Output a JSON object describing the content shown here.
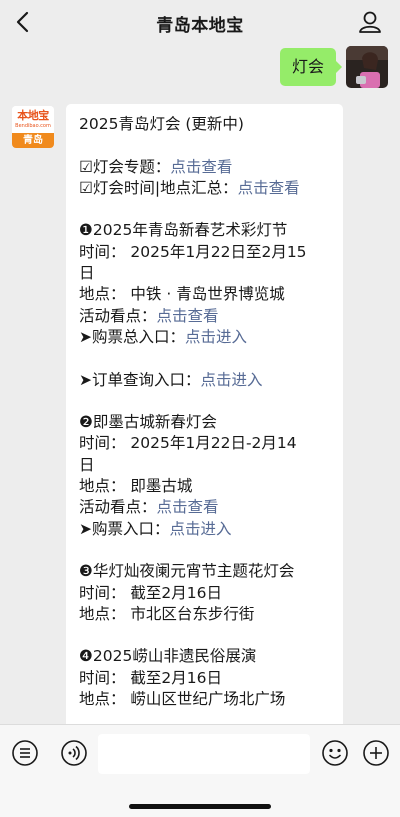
{
  "nav": {
    "title": "青岛本地宝",
    "back_icon": "chevron-left-icon",
    "profile_icon": "person-icon"
  },
  "outgoing": {
    "text": "灯会"
  },
  "incoming": {
    "avatar": {
      "logo_cn": "本地宝",
      "logo_en": "Bendibao.com",
      "city": "青岛"
    },
    "lines": [
      {
        "text": "2025青岛灯会 (更新中)",
        "link": ""
      },
      {
        "text": "",
        "link": ""
      },
      {
        "text": "☑灯会专题：",
        "link": "点击查看"
      },
      {
        "text": "☑灯会时间|地点汇总：",
        "link": "点击查看"
      },
      {
        "text": "",
        "link": ""
      },
      {
        "text": "❶2025年青岛新春艺术彩灯节",
        "link": ""
      },
      {
        "text": "时间： 2025年1月22日至2月15",
        "link": ""
      },
      {
        "text": "日",
        "link": ""
      },
      {
        "text": "地点： 中铁 · 青岛世界博览城",
        "link": ""
      },
      {
        "text": "活动看点：",
        "link": "点击查看"
      },
      {
        "text": "➤购票总入口：",
        "link": "点击进入"
      },
      {
        "text": "",
        "link": ""
      },
      {
        "text": "➤订单查询入口：",
        "link": "点击进入"
      },
      {
        "text": "",
        "link": ""
      },
      {
        "text": "❷即墨古城新春灯会",
        "link": ""
      },
      {
        "text": "时间： 2025年1月22日-2月14",
        "link": ""
      },
      {
        "text": "日",
        "link": ""
      },
      {
        "text": "地点： 即墨古城",
        "link": ""
      },
      {
        "text": "活动看点：",
        "link": "点击查看"
      },
      {
        "text": "➤购票入口：",
        "link": "点击进入"
      },
      {
        "text": "",
        "link": ""
      },
      {
        "text": "❸华灯灿夜阑元宵节主题花灯会",
        "link": ""
      },
      {
        "text": "时间： 截至2月16日",
        "link": ""
      },
      {
        "text": "地点： 市北区台东步行街",
        "link": ""
      },
      {
        "text": "",
        "link": ""
      },
      {
        "text": "❹2025崂山非遗民俗展演",
        "link": ""
      },
      {
        "text": "时间： 截至2月16日",
        "link": ""
      },
      {
        "text": "地点： 崂山区世纪广场北广场",
        "link": ""
      },
      {
        "text": "",
        "link": ""
      }
    ]
  },
  "inputbar": {
    "menu_icon": "list-menu-icon",
    "voice_icon": "voice-icon",
    "emoji_icon": "emoji-icon",
    "plus_icon": "plus-icon"
  },
  "colors": {
    "background": "#ededed",
    "outgoing_bubble": "#95ec69",
    "link": "#576b95",
    "brand_orange": "#f08a1d"
  }
}
